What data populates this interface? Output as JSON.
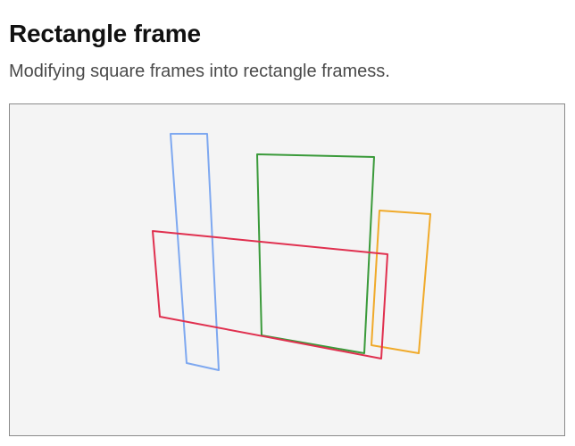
{
  "header": {
    "title": "Rectangle frame",
    "subtitle": "Modifying square frames into rectangle framess."
  },
  "frames": [
    {
      "color": "#7ea8f0"
    },
    {
      "color": "#3a9a3a"
    },
    {
      "color": "#f0aa2a"
    },
    {
      "color": "#e0304f"
    }
  ]
}
